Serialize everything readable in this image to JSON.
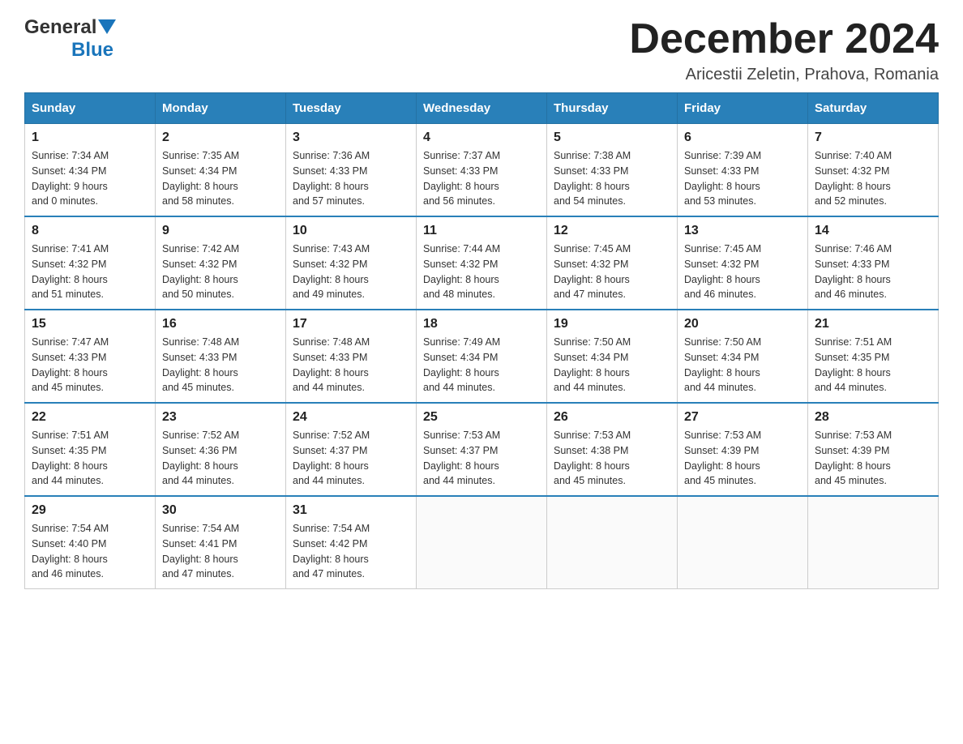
{
  "header": {
    "logo_general": "General",
    "logo_blue": "Blue",
    "month_title": "December 2024",
    "location": "Aricestii Zeletin, Prahova, Romania"
  },
  "days_of_week": [
    "Sunday",
    "Monday",
    "Tuesday",
    "Wednesday",
    "Thursday",
    "Friday",
    "Saturday"
  ],
  "weeks": [
    [
      {
        "day": "1",
        "sunrise": "7:34 AM",
        "sunset": "4:34 PM",
        "daylight_hours": "9",
        "daylight_minutes": "0"
      },
      {
        "day": "2",
        "sunrise": "7:35 AM",
        "sunset": "4:34 PM",
        "daylight_hours": "8",
        "daylight_minutes": "58"
      },
      {
        "day": "3",
        "sunrise": "7:36 AM",
        "sunset": "4:33 PM",
        "daylight_hours": "8",
        "daylight_minutes": "57"
      },
      {
        "day": "4",
        "sunrise": "7:37 AM",
        "sunset": "4:33 PM",
        "daylight_hours": "8",
        "daylight_minutes": "56"
      },
      {
        "day": "5",
        "sunrise": "7:38 AM",
        "sunset": "4:33 PM",
        "daylight_hours": "8",
        "daylight_minutes": "54"
      },
      {
        "day": "6",
        "sunrise": "7:39 AM",
        "sunset": "4:33 PM",
        "daylight_hours": "8",
        "daylight_minutes": "53"
      },
      {
        "day": "7",
        "sunrise": "7:40 AM",
        "sunset": "4:32 PM",
        "daylight_hours": "8",
        "daylight_minutes": "52"
      }
    ],
    [
      {
        "day": "8",
        "sunrise": "7:41 AM",
        "sunset": "4:32 PM",
        "daylight_hours": "8",
        "daylight_minutes": "51"
      },
      {
        "day": "9",
        "sunrise": "7:42 AM",
        "sunset": "4:32 PM",
        "daylight_hours": "8",
        "daylight_minutes": "50"
      },
      {
        "day": "10",
        "sunrise": "7:43 AM",
        "sunset": "4:32 PM",
        "daylight_hours": "8",
        "daylight_minutes": "49"
      },
      {
        "day": "11",
        "sunrise": "7:44 AM",
        "sunset": "4:32 PM",
        "daylight_hours": "8",
        "daylight_minutes": "48"
      },
      {
        "day": "12",
        "sunrise": "7:45 AM",
        "sunset": "4:32 PM",
        "daylight_hours": "8",
        "daylight_minutes": "47"
      },
      {
        "day": "13",
        "sunrise": "7:45 AM",
        "sunset": "4:32 PM",
        "daylight_hours": "8",
        "daylight_minutes": "46"
      },
      {
        "day": "14",
        "sunrise": "7:46 AM",
        "sunset": "4:33 PM",
        "daylight_hours": "8",
        "daylight_minutes": "46"
      }
    ],
    [
      {
        "day": "15",
        "sunrise": "7:47 AM",
        "sunset": "4:33 PM",
        "daylight_hours": "8",
        "daylight_minutes": "45"
      },
      {
        "day": "16",
        "sunrise": "7:48 AM",
        "sunset": "4:33 PM",
        "daylight_hours": "8",
        "daylight_minutes": "45"
      },
      {
        "day": "17",
        "sunrise": "7:48 AM",
        "sunset": "4:33 PM",
        "daylight_hours": "8",
        "daylight_minutes": "44"
      },
      {
        "day": "18",
        "sunrise": "7:49 AM",
        "sunset": "4:34 PM",
        "daylight_hours": "8",
        "daylight_minutes": "44"
      },
      {
        "day": "19",
        "sunrise": "7:50 AM",
        "sunset": "4:34 PM",
        "daylight_hours": "8",
        "daylight_minutes": "44"
      },
      {
        "day": "20",
        "sunrise": "7:50 AM",
        "sunset": "4:34 PM",
        "daylight_hours": "8",
        "daylight_minutes": "44"
      },
      {
        "day": "21",
        "sunrise": "7:51 AM",
        "sunset": "4:35 PM",
        "daylight_hours": "8",
        "daylight_minutes": "44"
      }
    ],
    [
      {
        "day": "22",
        "sunrise": "7:51 AM",
        "sunset": "4:35 PM",
        "daylight_hours": "8",
        "daylight_minutes": "44"
      },
      {
        "day": "23",
        "sunrise": "7:52 AM",
        "sunset": "4:36 PM",
        "daylight_hours": "8",
        "daylight_minutes": "44"
      },
      {
        "day": "24",
        "sunrise": "7:52 AM",
        "sunset": "4:37 PM",
        "daylight_hours": "8",
        "daylight_minutes": "44"
      },
      {
        "day": "25",
        "sunrise": "7:53 AM",
        "sunset": "4:37 PM",
        "daylight_hours": "8",
        "daylight_minutes": "44"
      },
      {
        "day": "26",
        "sunrise": "7:53 AM",
        "sunset": "4:38 PM",
        "daylight_hours": "8",
        "daylight_minutes": "45"
      },
      {
        "day": "27",
        "sunrise": "7:53 AM",
        "sunset": "4:39 PM",
        "daylight_hours": "8",
        "daylight_minutes": "45"
      },
      {
        "day": "28",
        "sunrise": "7:53 AM",
        "sunset": "4:39 PM",
        "daylight_hours": "8",
        "daylight_minutes": "45"
      }
    ],
    [
      {
        "day": "29",
        "sunrise": "7:54 AM",
        "sunset": "4:40 PM",
        "daylight_hours": "8",
        "daylight_minutes": "46"
      },
      {
        "day": "30",
        "sunrise": "7:54 AM",
        "sunset": "4:41 PM",
        "daylight_hours": "8",
        "daylight_minutes": "47"
      },
      {
        "day": "31",
        "sunrise": "7:54 AM",
        "sunset": "4:42 PM",
        "daylight_hours": "8",
        "daylight_minutes": "47"
      },
      null,
      null,
      null,
      null
    ]
  ]
}
